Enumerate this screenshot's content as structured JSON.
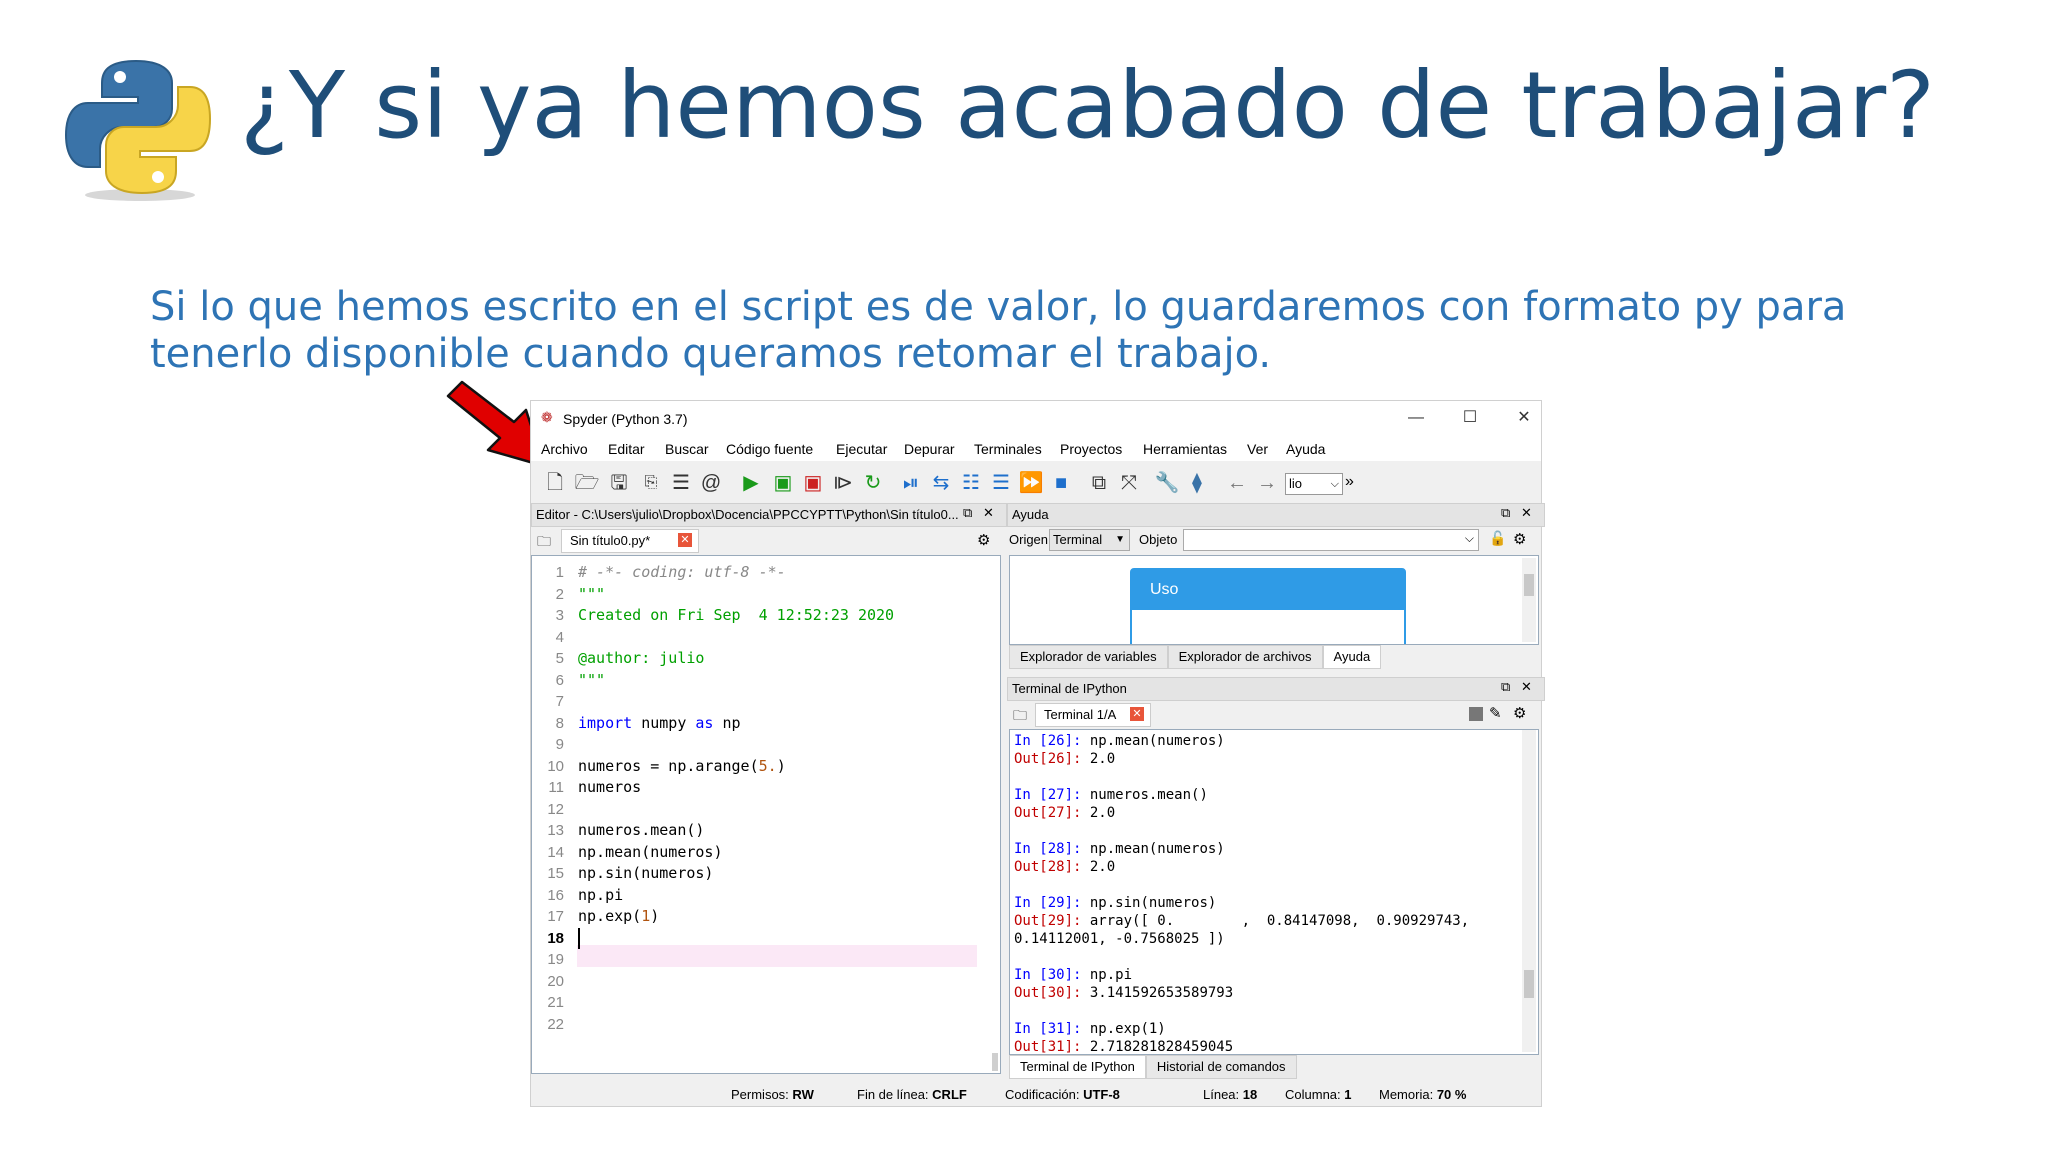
{
  "slide": {
    "title": "¿Y si ya hemos acabado de trabajar?",
    "body": "Si lo que hemos escrito en el script es de valor, lo guardaremos con formato py para tenerlo disponible cuando queramos retomar el trabajo."
  },
  "window": {
    "title": "Spyder (Python 3.7)",
    "controls": {
      "minimize": "—",
      "maximize": "☐",
      "close": "✕"
    }
  },
  "menu": [
    "Archivo",
    "Editar",
    "Buscar",
    "Código fuente",
    "Ejecutar",
    "Depurar",
    "Terminales",
    "Proyectos",
    "Herramientas",
    "Ver",
    "Ayuda"
  ],
  "toolbar": {
    "dir_value": "lio",
    "more": "»"
  },
  "editor": {
    "header": "Editor - C:\\Users\\julio\\Dropbox\\Docencia\\PPCCYPTT\\Python\\Sin título0...",
    "tab_label": "Sin título0.py*",
    "current_line": "18",
    "lines": [
      {
        "n": "1",
        "code": "# -*- coding: utf-8 -*-"
      },
      {
        "n": "2",
        "code": "\"\"\""
      },
      {
        "n": "3",
        "code": "Created on Fri Sep  4 12:52:23 2020"
      },
      {
        "n": "4",
        "code": ""
      },
      {
        "n": "5",
        "code": "@author: julio"
      },
      {
        "n": "6",
        "code": "\"\"\""
      },
      {
        "n": "7",
        "code": ""
      },
      {
        "n": "8",
        "code": "import numpy as np"
      },
      {
        "n": "9",
        "code": ""
      },
      {
        "n": "10",
        "code": "numeros = np.arange(5.)"
      },
      {
        "n": "11",
        "code": "numeros"
      },
      {
        "n": "12",
        "code": ""
      },
      {
        "n": "13",
        "code": "numeros.mean()"
      },
      {
        "n": "14",
        "code": "np.mean(numeros)"
      },
      {
        "n": "15",
        "code": "np.sin(numeros)"
      },
      {
        "n": "16",
        "code": "np.pi"
      },
      {
        "n": "17",
        "code": "np.exp(1)"
      },
      {
        "n": "18",
        "code": ""
      },
      {
        "n": "19",
        "code": ""
      },
      {
        "n": "20",
        "code": ""
      },
      {
        "n": "21",
        "code": ""
      },
      {
        "n": "22",
        "code": ""
      }
    ]
  },
  "help": {
    "header": "Ayuda",
    "origin_label": "Origen",
    "origin_value": "Terminal",
    "object_label": "Objeto",
    "card_title": "Uso",
    "tabs": [
      "Explorador de variables",
      "Explorador de archivos",
      "Ayuda"
    ]
  },
  "console": {
    "header": "Terminal de IPython",
    "tab_label": "Terminal 1/A",
    "lines": [
      {
        "cls": "in",
        "prompt": "In [26]:",
        "text": " np.mean(numeros)"
      },
      {
        "cls": "out",
        "prompt": "Out[26]:",
        "text": " 2.0"
      },
      {
        "cls": "",
        "prompt": "",
        "text": ""
      },
      {
        "cls": "in",
        "prompt": "In [27]:",
        "text": " numeros.mean()"
      },
      {
        "cls": "out",
        "prompt": "Out[27]:",
        "text": " 2.0"
      },
      {
        "cls": "",
        "prompt": "",
        "text": ""
      },
      {
        "cls": "in",
        "prompt": "In [28]:",
        "text": " np.mean(numeros)"
      },
      {
        "cls": "out",
        "prompt": "Out[28]:",
        "text": " 2.0"
      },
      {
        "cls": "",
        "prompt": "",
        "text": ""
      },
      {
        "cls": "in",
        "prompt": "In [29]:",
        "text": " np.sin(numeros)"
      },
      {
        "cls": "out",
        "prompt": "Out[29]:",
        "text": " array([ 0.        ,  0.84147098,  0.90929743,"
      },
      {
        "cls": "",
        "prompt": "",
        "text": "0.14112001, -0.7568025 ])"
      },
      {
        "cls": "",
        "prompt": "",
        "text": ""
      },
      {
        "cls": "in",
        "prompt": "In [30]:",
        "text": " np.pi"
      },
      {
        "cls": "out",
        "prompt": "Out[30]:",
        "text": " 3.141592653589793"
      },
      {
        "cls": "",
        "prompt": "",
        "text": ""
      },
      {
        "cls": "in",
        "prompt": "In [31]:",
        "text": " np.exp(1)"
      },
      {
        "cls": "out",
        "prompt": "Out[31]:",
        "text": " 2.718281828459045"
      }
    ],
    "bottom_tabs": [
      "Terminal de IPython",
      "Historial de comandos"
    ]
  },
  "status": {
    "permisos_label": "Permisos:",
    "permisos": "RW",
    "eol_label": "Fin de línea:",
    "eol": "CRLF",
    "enc_label": "Codificación:",
    "enc": "UTF-8",
    "line_label": "Línea:",
    "line": "18",
    "col_label": "Columna:",
    "col": "1",
    "mem_label": "Memoria:",
    "mem": "70 %"
  },
  "colors": {
    "title": "#1f4e79",
    "body": "#2e74b5",
    "arrow": "#e00000",
    "help_card": "#2f9be6"
  }
}
